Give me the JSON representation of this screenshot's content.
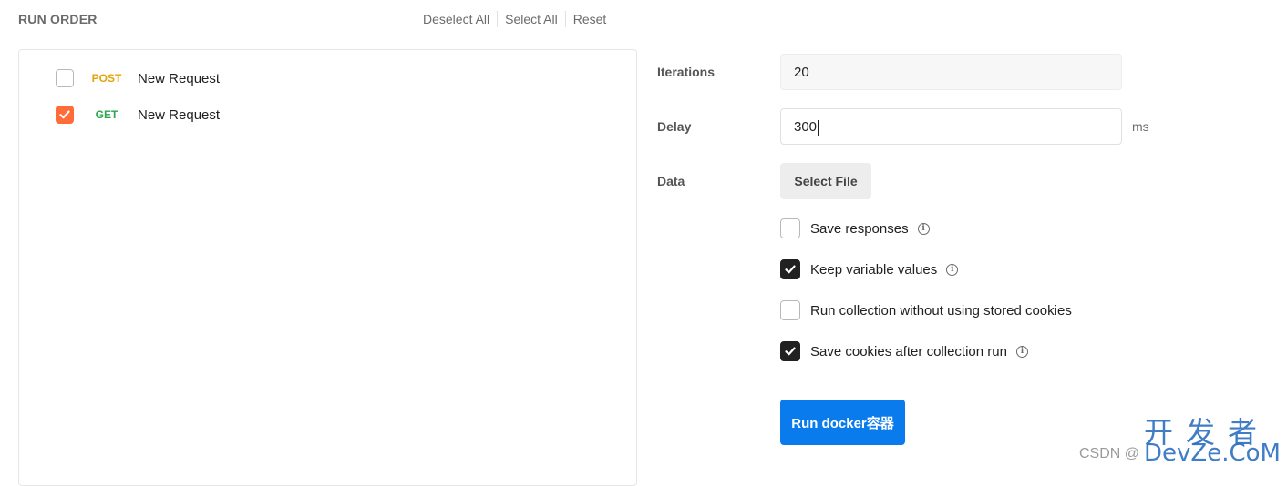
{
  "header": {
    "title": "RUN ORDER",
    "actions": [
      "Deselect All",
      "Select All",
      "Reset"
    ]
  },
  "requests": [
    {
      "method": "POST",
      "method_color": "#e5a20b",
      "name": "New Request",
      "checked": false
    },
    {
      "method": "GET",
      "method_color": "#2ea44f",
      "name": "New Request",
      "checked": true
    }
  ],
  "settings": {
    "iterations_label": "Iterations",
    "iterations_value": "20",
    "delay_label": "Delay",
    "delay_value": "300",
    "delay_unit": "ms",
    "data_label": "Data",
    "select_file_label": "Select File"
  },
  "options": [
    {
      "label": "Save responses",
      "checked": false,
      "info": true
    },
    {
      "label": "Keep variable values",
      "checked": true,
      "info": true
    },
    {
      "label": "Run collection without using stored cookies",
      "checked": false,
      "info": false
    },
    {
      "label": "Save cookies after collection run",
      "checked": true,
      "info": true
    }
  ],
  "run_button": "Run docker容器",
  "watermark": {
    "csdn": "CSDN @",
    "brand": "开发者",
    "url": "DevZe.CoM"
  },
  "colors": {
    "accent": "#ff6c37",
    "primary": "#097bed",
    "post": "#e5a20b",
    "get": "#2ea44f"
  }
}
